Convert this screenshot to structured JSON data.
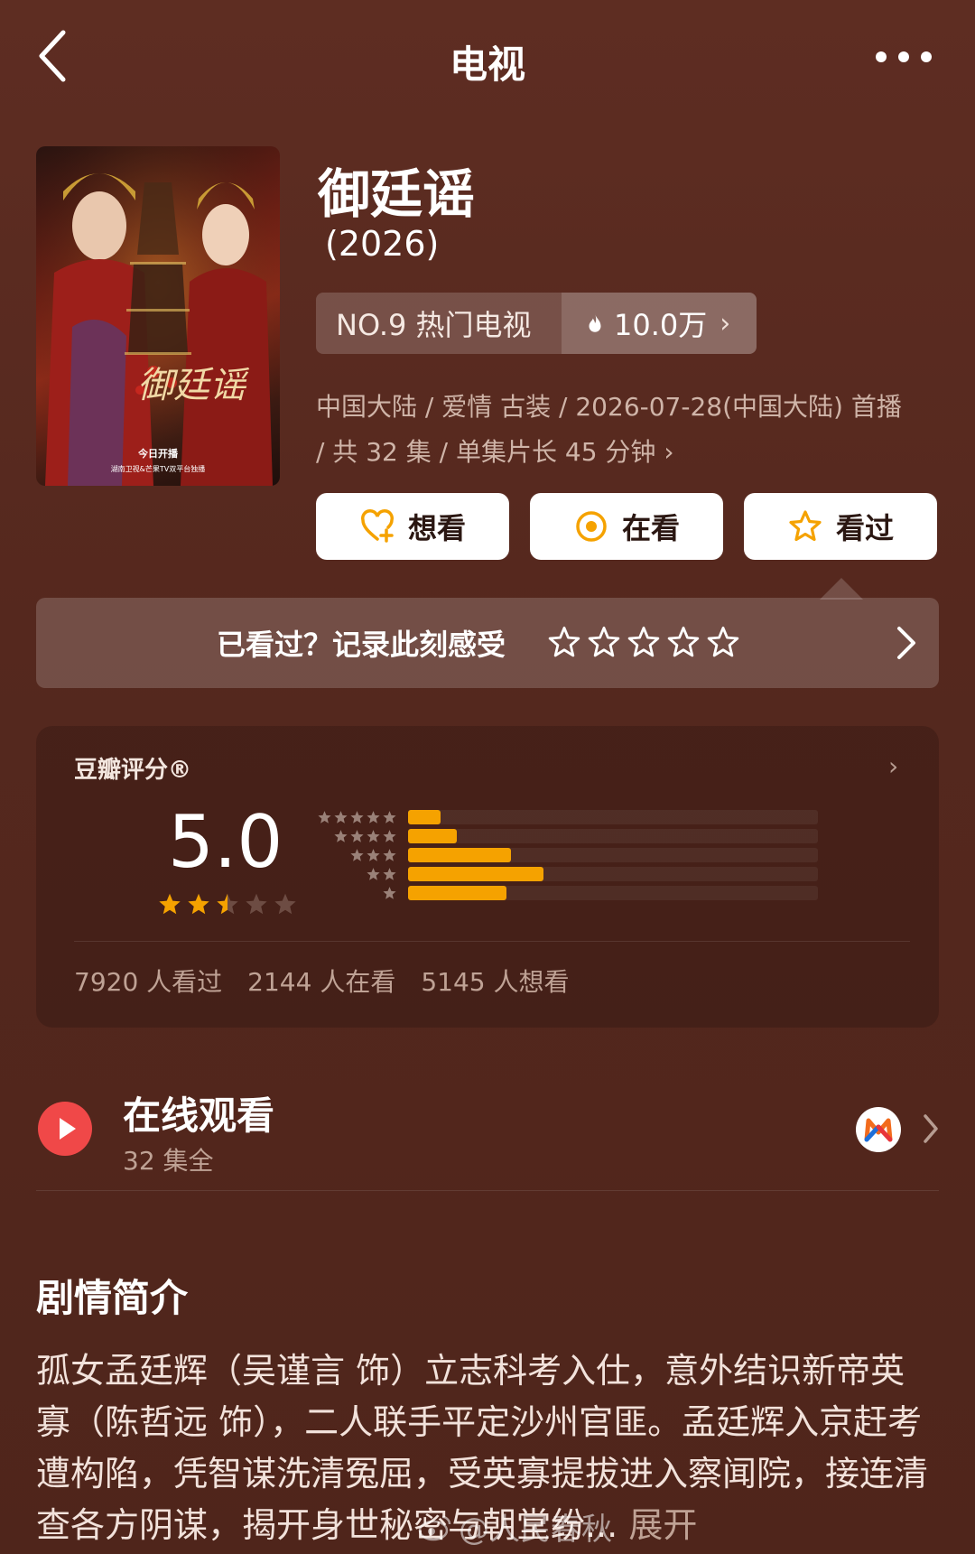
{
  "nav": {
    "title": "电视"
  },
  "show": {
    "title": "御廷谣",
    "year": "(2026)",
    "rank_label": "NO.9 热门电视",
    "heat": "10.0万",
    "meta": "中国大陆 / 爱情 古装 / 2026-07-28(中国大陆) 首播 / 共 32 集 / 单集片长 45 分钟",
    "meta_chevron": "›"
  },
  "poster": {
    "title_calligraphy": "御廷谣",
    "caption_line1": "今日开播",
    "caption_line2": "湖南卫视&芒果TV双平台独播"
  },
  "actions": {
    "want": "想看",
    "watching": "在看",
    "watched": "看过"
  },
  "rate_prompt": {
    "text": "已看过？记录此刻感受",
    "star_count": 5
  },
  "douban": {
    "label": "豆瓣评分®",
    "chevron": "›",
    "score": "5.0",
    "score_value": 5.0,
    "star_rating_of_5": 2.5,
    "distribution": [
      {
        "stars": 5,
        "share": 0.08
      },
      {
        "stars": 4,
        "share": 0.12
      },
      {
        "stars": 3,
        "share": 0.25
      },
      {
        "stars": 2,
        "share": 0.33
      },
      {
        "stars": 1,
        "share": 0.24
      }
    ],
    "counts": {
      "watched": "7920 人看过",
      "watching": "2144 人在看",
      "want": "5145 人想看"
    }
  },
  "online": {
    "title": "在线观看",
    "subtitle": "32 集全",
    "provider_icon": "mango-tv-logo"
  },
  "synopsis": {
    "title": "剧情简介",
    "text": "孤女孟廷辉（吴谨言 饰）立志科考入仕，意外结识新帝英寡（陈哲远 饰），二人联手平定沙州官匪。孟廷辉入京赶考遭构陷，凭智谋洗清冤屈，受英寡提拔进入察闻院，接连清查各方阴谋，揭开身世秘密与朝堂纷...",
    "expand": "展开"
  },
  "watermark": {
    "text": "@人民春秋"
  },
  "colors": {
    "background": "#5a2a20",
    "accent_orange": "#f5a200",
    "play_red": "#f04848",
    "button_bg": "#ffffff"
  }
}
